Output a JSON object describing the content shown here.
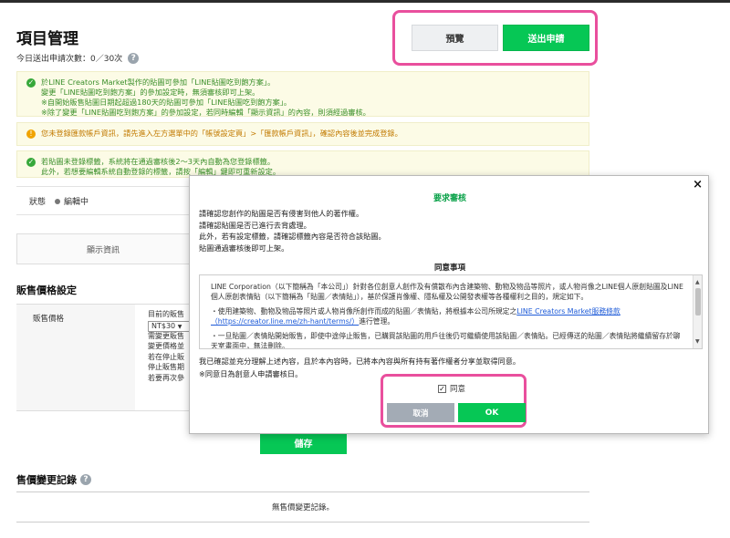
{
  "header": {
    "title": "項目管理",
    "daily_count": "今日送出申請次數：0／30次",
    "preview_label": "預覽",
    "submit_label": "送出申請"
  },
  "notices": [
    {
      "lines": [
        "於LINE Creators Market製作的貼圖可參加「LINE貼圖吃到飽方案」。",
        "變更「LINE貼圖吃到飽方案」的參加設定時，無須審核即可上架。",
        "※自開始販售貼圖日期起超過180天的貼圖可參加「LINE貼圖吃到飽方案」。",
        "※除了變更「LINE貼圖吃到飽方案」的參加設定，若同時編輯「顯示資訊」的內容，則須經過審核。"
      ]
    },
    {
      "lines": [
        "您未登錄匯款帳戶資訊，請先進入左方選單中的「帳號設定頁」>「匯款帳戶資訊」，確認內容後並完成登錄。"
      ]
    },
    {
      "lines": [
        "若貼圖未登錄標籤，系統將在通過審核後2～3天內自動為您登錄標籤。",
        "此外，若想要編輯系統自動登錄的標籤，請按「編輯」鍵即可重新設定。"
      ]
    }
  ],
  "status": {
    "label": "狀態",
    "value": "編輯中"
  },
  "tabs": {
    "display_info": "顯示資訊"
  },
  "pricing": {
    "section_title": "販售價格設定",
    "row_label": "販售價格",
    "current_price_line": "目前的販售",
    "selected_option": "NT$30",
    "lines": [
      "需變更販售",
      "變更價格並",
      "若在停止販",
      "停止販售期",
      "若要再次參"
    ]
  },
  "save_label": "儲存",
  "history": {
    "title": "售價變更記錄",
    "empty_text": "無售價變更記錄。"
  },
  "modal": {
    "title": "要求審核",
    "close": "×",
    "intro": [
      "請確認您創作的貼圖是否有侵害到他人的著作權。",
      "請確認貼圖是否已進行去背處理。",
      "此外，若有設定標籤，請確認標籤內容是否符合該貼圖。",
      "貼圖通過審核後即可上架。"
    ],
    "agreement_heading": "同意事項",
    "terms_p1": "LINE Corporation（以下簡稱為「本公司」）針對各位創意人創作及有償散布內含建築物、動物及物品等照片，或人物肖像之LINE個人原創貼圖及LINE個人原創表情貼（以下簡稱為「貼圖／表情貼」），基於保護肖像權、隱私權及公開發表權等各種權利之目的，規定如下。",
    "terms_p2_prefix": "・使用建築物、動物及物品等照片或人物肖像所創作而成的貼圖／表情貼，將根據本公司所規定之",
    "terms_p2_link": "LINE Creators Market服務條款（https://creator.line.me/zh-hant/terms/）",
    "terms_p2_suffix": "進行管理。",
    "terms_p3": "・一旦貼圖／表情貼開始販售，即使中途停止販售，已購買該貼圖的用戶往後仍可繼續使用該貼圖／表情貼。已經傳送的貼圖／表情貼將繼續留存於聊天室畫面中，無法刪除。",
    "confirm_line1": "我已確認並充分理解上述內容，且於本內容時，已將本內容與所有持有著作權者分享並取得同意。",
    "confirm_line2": "※同意日為創意人申請審核日。",
    "agree_label": "同意",
    "cancel_label": "取消",
    "ok_label": "OK"
  },
  "colors": {
    "brand_green": "#06c755",
    "highlight_pink": "#e94f9d",
    "notice_bg": "#fcfbe6"
  }
}
